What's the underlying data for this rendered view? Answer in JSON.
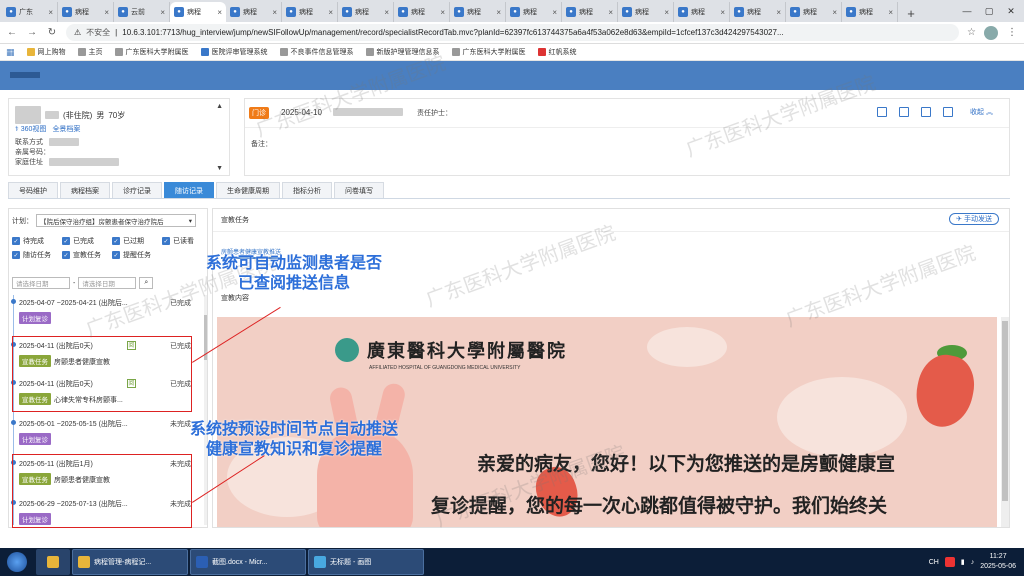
{
  "browser": {
    "tabs": [
      {
        "label": "广东",
        "icon": "hospital-favicon",
        "active": false
      },
      {
        "label": "病程",
        "icon": "hospital-favicon",
        "active": false
      },
      {
        "label": "云前",
        "icon": "hospital-favicon",
        "active": false
      },
      {
        "label": "病程",
        "icon": "hospital-favicon",
        "active": true
      },
      {
        "label": "病程",
        "icon": "hospital-favicon",
        "active": false
      },
      {
        "label": "病程",
        "icon": "hospital-favicon",
        "active": false
      },
      {
        "label": "病程",
        "icon": "hospital-favicon",
        "active": false
      },
      {
        "label": "病程",
        "icon": "hospital-favicon",
        "active": false
      },
      {
        "label": "病程",
        "icon": "hospital-favicon",
        "active": false
      },
      {
        "label": "病程",
        "icon": "hospital-favicon",
        "active": false
      },
      {
        "label": "病程",
        "icon": "hospital-favicon",
        "active": false
      },
      {
        "label": "病程",
        "icon": "hospital-favicon",
        "active": false
      },
      {
        "label": "病程",
        "icon": "hospital-favicon",
        "active": false
      },
      {
        "label": "病程",
        "icon": "hospital-favicon",
        "active": false
      },
      {
        "label": "病程",
        "icon": "hospital-favicon",
        "active": false
      },
      {
        "label": "病程",
        "icon": "hospital-favicon",
        "active": false
      }
    ],
    "insecure_label": "不安全",
    "url": "10.6.3.101:7713/hug_interview/jump/newSIFollowUp/management/record/specialistRecordTab.mvc?planId=62397fc613744375a6a4f53a062e8d63&empiId=1cfcef137c3d424297543027..."
  },
  "bookmarks": [
    {
      "label": "网上购物",
      "icon": "folder-icon"
    },
    {
      "label": "主页",
      "icon": "page-icon"
    },
    {
      "label": "广东医科大学附属医",
      "icon": "page-icon"
    },
    {
      "label": "医院评审管理系统",
      "icon": "k-icon"
    },
    {
      "label": "不良事件信息管理系",
      "icon": "page-icon"
    },
    {
      "label": "新版护理管理信息系",
      "icon": "page-icon"
    },
    {
      "label": "广东医科大学附属医",
      "icon": "page-icon"
    },
    {
      "label": "红帆系统",
      "icon": "red-icon"
    }
  ],
  "patient": {
    "status": "(非住院)",
    "gender": "男",
    "age": "70岁",
    "view360": "360视图",
    "full_record": "全景档案",
    "label_contact": "联系方式",
    "label_family": "亲属号码：",
    "label_address": "家庭住址"
  },
  "visit": {
    "badge": "门诊",
    "date": "2025-04-10",
    "nurse_label": "责任护士：",
    "note_label": "备注：",
    "collapse_label": "收起"
  },
  "nav_tabs": [
    {
      "label": "号码维护",
      "active": false
    },
    {
      "label": "病程档案",
      "active": false
    },
    {
      "label": "诊疗记录",
      "active": false
    },
    {
      "label": "随访记录",
      "active": true
    },
    {
      "label": "生命健康周期",
      "active": false
    },
    {
      "label": "指标分析",
      "active": false
    },
    {
      "label": "问卷填写",
      "active": false
    }
  ],
  "left": {
    "plan_label": "计划：",
    "plan_value": "【院后保守治疗组】房颤患者保守治疗院后",
    "filters": [
      "待完成",
      "已完成",
      "已过期",
      "已读看",
      "随访任务",
      "宣教任务",
      "提醒任务"
    ],
    "start_placeholder": "请选择日期",
    "end_placeholder": "请选择日期",
    "records": [
      {
        "date": "2025-04-07 ~2025-04-21 (出院后...",
        "status": "已完成",
        "tag": "计划复诊",
        "tag_color": "#9a6ac6",
        "desc": "",
        "read": false
      },
      {
        "date": "2025-04-11 (出院后0天)",
        "status": "已完成",
        "tag": "宣教任务",
        "tag_color": "#8aa63a",
        "desc": "房颤患者健康宣教",
        "read": true
      },
      {
        "date": "2025-04-11 (出院后0天)",
        "status": "已完成",
        "tag": "宣教任务",
        "tag_color": "#8aa63a",
        "desc": "心律失常专科房颤事...",
        "read": true
      },
      {
        "date": "2025-05-01 ~2025-05-15 (出院后...",
        "status": "未完成",
        "tag": "计划复诊",
        "tag_color": "#9a6ac6",
        "desc": "",
        "read": false
      },
      {
        "date": "2025-05-11 (出院后1月)",
        "status": "未完成",
        "tag": "宣教任务",
        "tag_color": "#8aa63a",
        "desc": "房颤患者健康宣教",
        "read": false
      },
      {
        "date": "2025-06-29 ~2025-07-13 (出院后...",
        "status": "未完成",
        "tag": "计划复诊",
        "tag_color": "#9a6ac6",
        "desc": "",
        "read": false
      }
    ]
  },
  "right": {
    "title": "宣教任务",
    "manual_send": "手动发送",
    "subtab": "房颤患者健康宣教推送",
    "content_label": "宣教内容",
    "banner": {
      "hospital_cn": "廣東醫科大學附屬醫院",
      "hospital_en": "AFFILIATED HOSPITAL OF GUANGDONG MEDICAL UNIVERSITY",
      "line1": "亲爱的病友，您好！以下为您推送的是房颤健康宣",
      "line2": "复诊提醒，您的每一次心跳都值得被守护。我们始终关"
    }
  },
  "annotations": {
    "top_line1": "系统可自动监测患者是否",
    "top_line2": "已查阅推送信息",
    "bottom_line1": "系统按预设时间节点自动推送",
    "bottom_line2": "健康宣教知识和复诊提醒",
    "color": "#2d6fd9",
    "box_color": "#dd2222"
  },
  "watermark": "广东医科大学附属医院",
  "taskbar": {
    "items": [
      {
        "label": "病程管理-病程记...",
        "icon": "chrome-icon"
      },
      {
        "label": "截图.docx - Micr...",
        "icon": "word-icon"
      },
      {
        "label": "无标题 - 画图",
        "icon": "paint-icon"
      }
    ],
    "ime": "CH",
    "time": "11:27",
    "date": "2025-05-06"
  }
}
